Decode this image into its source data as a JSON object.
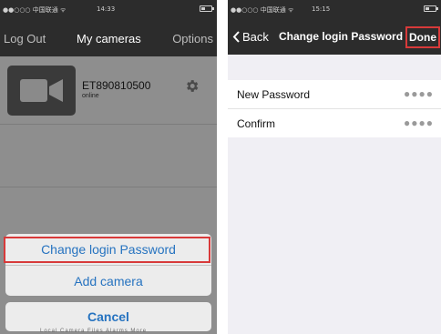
{
  "left_screen": {
    "status_bar": {
      "carrier": "●●○○○ 中国联通 ᯤ",
      "time": "14:33"
    },
    "nav": {
      "left": "Log Out",
      "title": "My cameras",
      "right": "Options"
    },
    "camera": {
      "name": "ET890810500",
      "status": "online",
      "thumb_icon": "video-camera-icon",
      "settings_icon": "gear-icon"
    },
    "action_sheet": {
      "items": [
        "Change login Password",
        "Add camera"
      ],
      "cancel": "Cancel",
      "highlight_color": "#d83a3a"
    },
    "tabbar_ghost": "Local Camera   Files   Alarms   More"
  },
  "right_screen": {
    "status_bar": {
      "carrier": "●●○○○ 中国联通 ᯤ",
      "time": "15:15"
    },
    "nav": {
      "back": "Back",
      "title": "Change login Password",
      "done": "Done"
    },
    "form": [
      {
        "label": "New Password",
        "value": "●●●●"
      },
      {
        "label": "Confirm",
        "value": "●●●●"
      }
    ]
  },
  "colors": {
    "nav_bg": "#2c2c2c",
    "action_text": "#2673c0",
    "overlay_bg": "#8e8e8e",
    "form_bg": "#f0eff4"
  }
}
